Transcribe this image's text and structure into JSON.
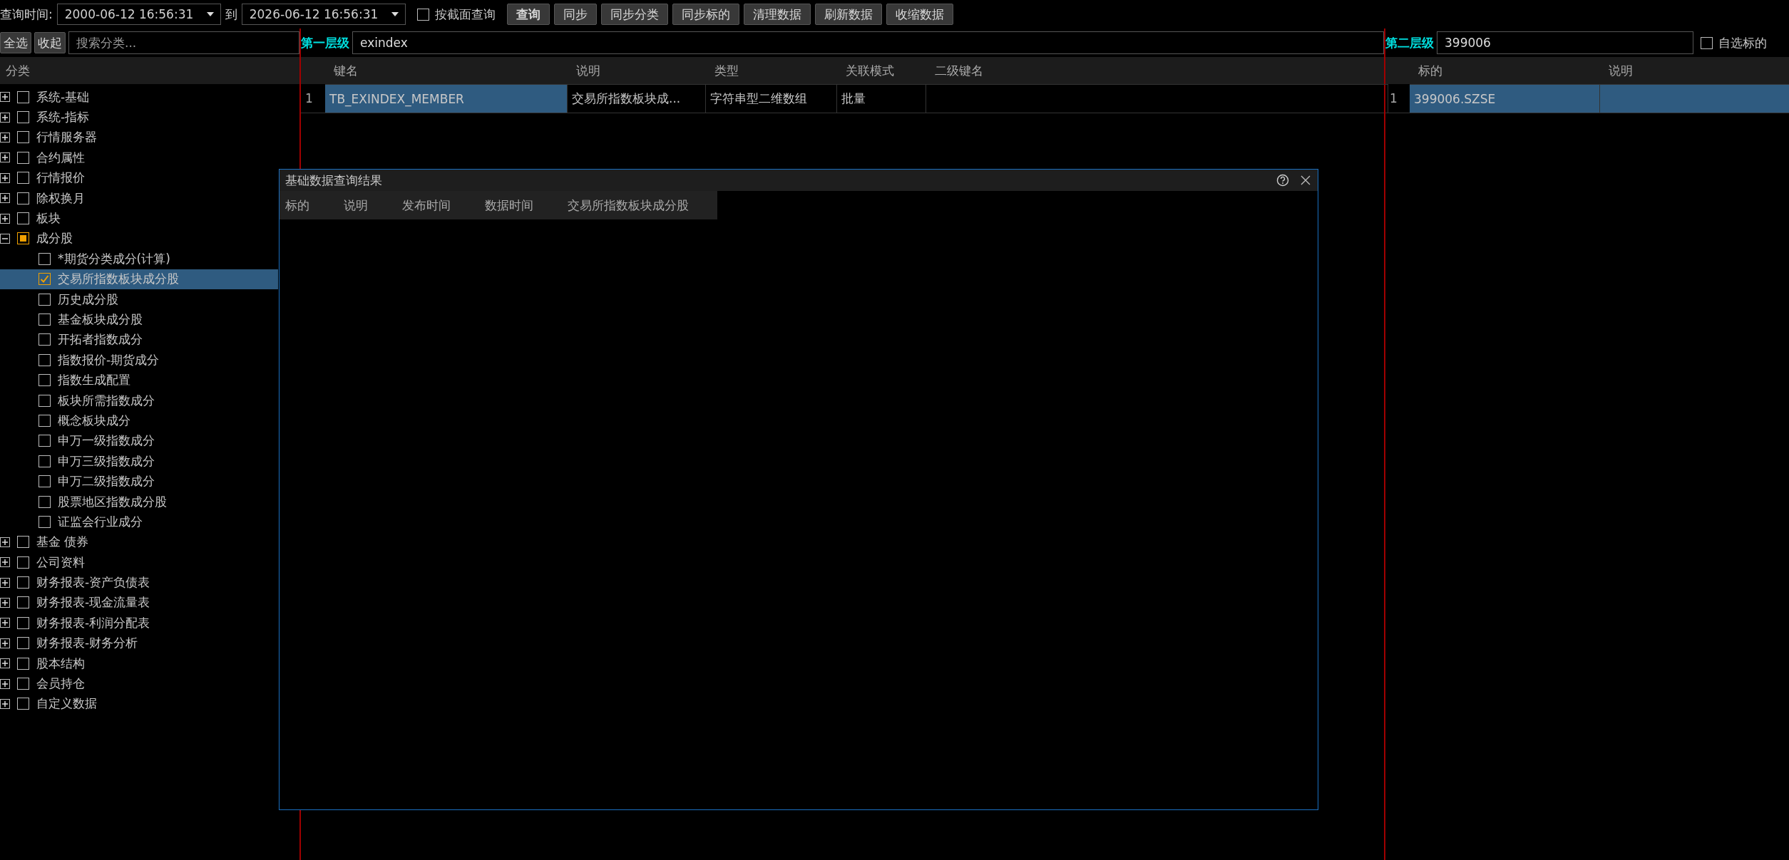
{
  "toolbar": {
    "time_label": "查询时间:",
    "start_time": "2000-06-12 16:56:31",
    "to_label": "到",
    "end_time": "2026-06-12 16:56:31",
    "section_query": {
      "label": "按截面查询",
      "checked": false
    },
    "buttons": [
      "查询",
      "同步",
      "同步分类",
      "同步标的",
      "清理数据",
      "刷新数据",
      "收缩数据"
    ]
  },
  "sidebar": {
    "buttons": [
      "全选",
      "收起"
    ],
    "search": {
      "placeholder": "搜索分类..."
    },
    "header": "分类",
    "tree": [
      {
        "label": "系统-基础",
        "expanded": false,
        "checked": false,
        "partial": false,
        "selected": false
      },
      {
        "label": "系统-指标",
        "expanded": false,
        "checked": false,
        "partial": false,
        "selected": false
      },
      {
        "label": "行情服务器",
        "expanded": false,
        "checked": false,
        "partial": false,
        "selected": false
      },
      {
        "label": "合约属性",
        "expanded": false,
        "checked": false,
        "partial": false,
        "selected": false
      },
      {
        "label": "行情报价",
        "expanded": false,
        "checked": false,
        "partial": false,
        "selected": false
      },
      {
        "label": "除权换月",
        "expanded": false,
        "checked": false,
        "partial": false,
        "selected": false
      },
      {
        "label": "板块",
        "expanded": false,
        "checked": false,
        "partial": false,
        "selected": false
      },
      {
        "label": "成分股",
        "expanded": true,
        "checked": false,
        "partial": true,
        "selected": false,
        "children": [
          {
            "label": "*期货分类成分(计算)",
            "checked": false,
            "selected": false
          },
          {
            "label": "交易所指数板块成分股",
            "checked": true,
            "selected": true
          },
          {
            "label": "历史成分股",
            "checked": false,
            "selected": false
          },
          {
            "label": "基金板块成分股",
            "checked": false,
            "selected": false
          },
          {
            "label": "开拓者指数成分",
            "checked": false,
            "selected": false
          },
          {
            "label": "指数报价-期货成分",
            "checked": false,
            "selected": false
          },
          {
            "label": "指数生成配置",
            "checked": false,
            "selected": false
          },
          {
            "label": "板块所需指数成分",
            "checked": false,
            "selected": false
          },
          {
            "label": "概念板块成分",
            "checked": false,
            "selected": false
          },
          {
            "label": "申万一级指数成分",
            "checked": false,
            "selected": false
          },
          {
            "label": "申万三级指数成分",
            "checked": false,
            "selected": false
          },
          {
            "label": "申万二级指数成分",
            "checked": false,
            "selected": false
          },
          {
            "label": "股票地区指数成分股",
            "checked": false,
            "selected": false
          },
          {
            "label": "证监会行业成分",
            "checked": false,
            "selected": false
          }
        ]
      },
      {
        "label": "基金 债券",
        "expanded": false,
        "checked": false,
        "partial": false,
        "selected": false
      },
      {
        "label": "公司资料",
        "expanded": false,
        "checked": false,
        "partial": false,
        "selected": false
      },
      {
        "label": "财务报表-资产负债表",
        "expanded": false,
        "checked": false,
        "partial": false,
        "selected": false
      },
      {
        "label": "财务报表-现金流量表",
        "expanded": false,
        "checked": false,
        "partial": false,
        "selected": false
      },
      {
        "label": "财务报表-利润分配表",
        "expanded": false,
        "checked": false,
        "partial": false,
        "selected": false
      },
      {
        "label": "财务报表-财务分析",
        "expanded": false,
        "checked": false,
        "partial": false,
        "selected": false
      },
      {
        "label": "股本结构",
        "expanded": false,
        "checked": false,
        "partial": false,
        "selected": false
      },
      {
        "label": "会员持仓",
        "expanded": false,
        "checked": false,
        "partial": false,
        "selected": false
      },
      {
        "label": "自定义数据",
        "expanded": false,
        "checked": false,
        "partial": false,
        "selected": false
      }
    ]
  },
  "level1": {
    "label": "第一层级",
    "value": "exindex",
    "columns": [
      "键名",
      "说明",
      "类型",
      "关联模式",
      "二级键名"
    ],
    "rows": [
      {
        "index": "1",
        "cells": [
          {
            "text": "TB_EXINDEX_MEMBER",
            "selected": true
          },
          {
            "text": "交易所指数板块成...",
            "selected": false
          },
          {
            "text": "字符串型二维数组",
            "selected": false
          },
          {
            "text": "批量",
            "selected": false
          },
          {
            "text": "",
            "selected": false
          }
        ]
      }
    ]
  },
  "level2": {
    "label": "第二层级",
    "value": "399006",
    "own_symbols": {
      "label": "自选标的",
      "checked": false
    },
    "columns": [
      "标的",
      "说明"
    ],
    "rows": [
      {
        "index": "1",
        "cells": [
          {
            "text": "399006.SZSE",
            "selected": true
          },
          {
            "text": "",
            "selected": true
          }
        ]
      }
    ]
  },
  "dialog": {
    "title": "基础数据查询结果",
    "columns": [
      "标的",
      "说明",
      "发布时间",
      "数据时间",
      "交易所指数板块成分股"
    ]
  }
}
